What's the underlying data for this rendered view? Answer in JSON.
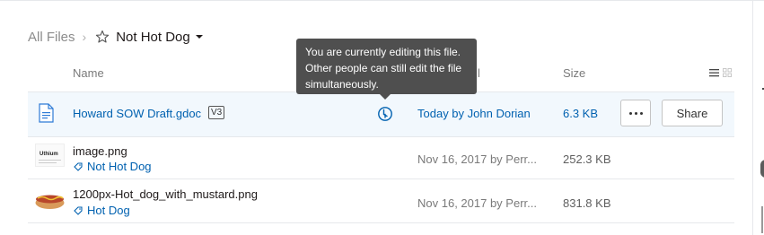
{
  "breadcrumb": {
    "root": "All Files",
    "separator": "›",
    "current": "Not Hot Dog"
  },
  "table": {
    "headers": {
      "name": "Name",
      "modified_fragment": "l",
      "size": "Size"
    }
  },
  "files": [
    {
      "name": "Howard SOW Draft.gdoc",
      "version_badge": "V3",
      "modified": "Today by John Dorian",
      "size": "6.3 KB",
      "icon": "google-doc-icon",
      "editing": true
    },
    {
      "name": "image.png",
      "tag": "Not Hot Dog",
      "modified": "Nov 16, 2017 by Perr...",
      "size": "252.3 KB",
      "thumbnail_text": "Uthium"
    },
    {
      "name": "1200px-Hot_dog_with_mustard.png",
      "tag": "Hot Dog",
      "modified": "Nov 16, 2017 by Perr...",
      "size": "831.8 KB"
    }
  ],
  "actions": {
    "share_label": "Share"
  },
  "tooltip": {
    "text": "You are currently editing this file. Other people can still edit the file simultaneously."
  },
  "colors": {
    "link": "#0061b0",
    "selected_row": "#f2f8fd",
    "tooltip_bg": "#4f4f4f"
  }
}
